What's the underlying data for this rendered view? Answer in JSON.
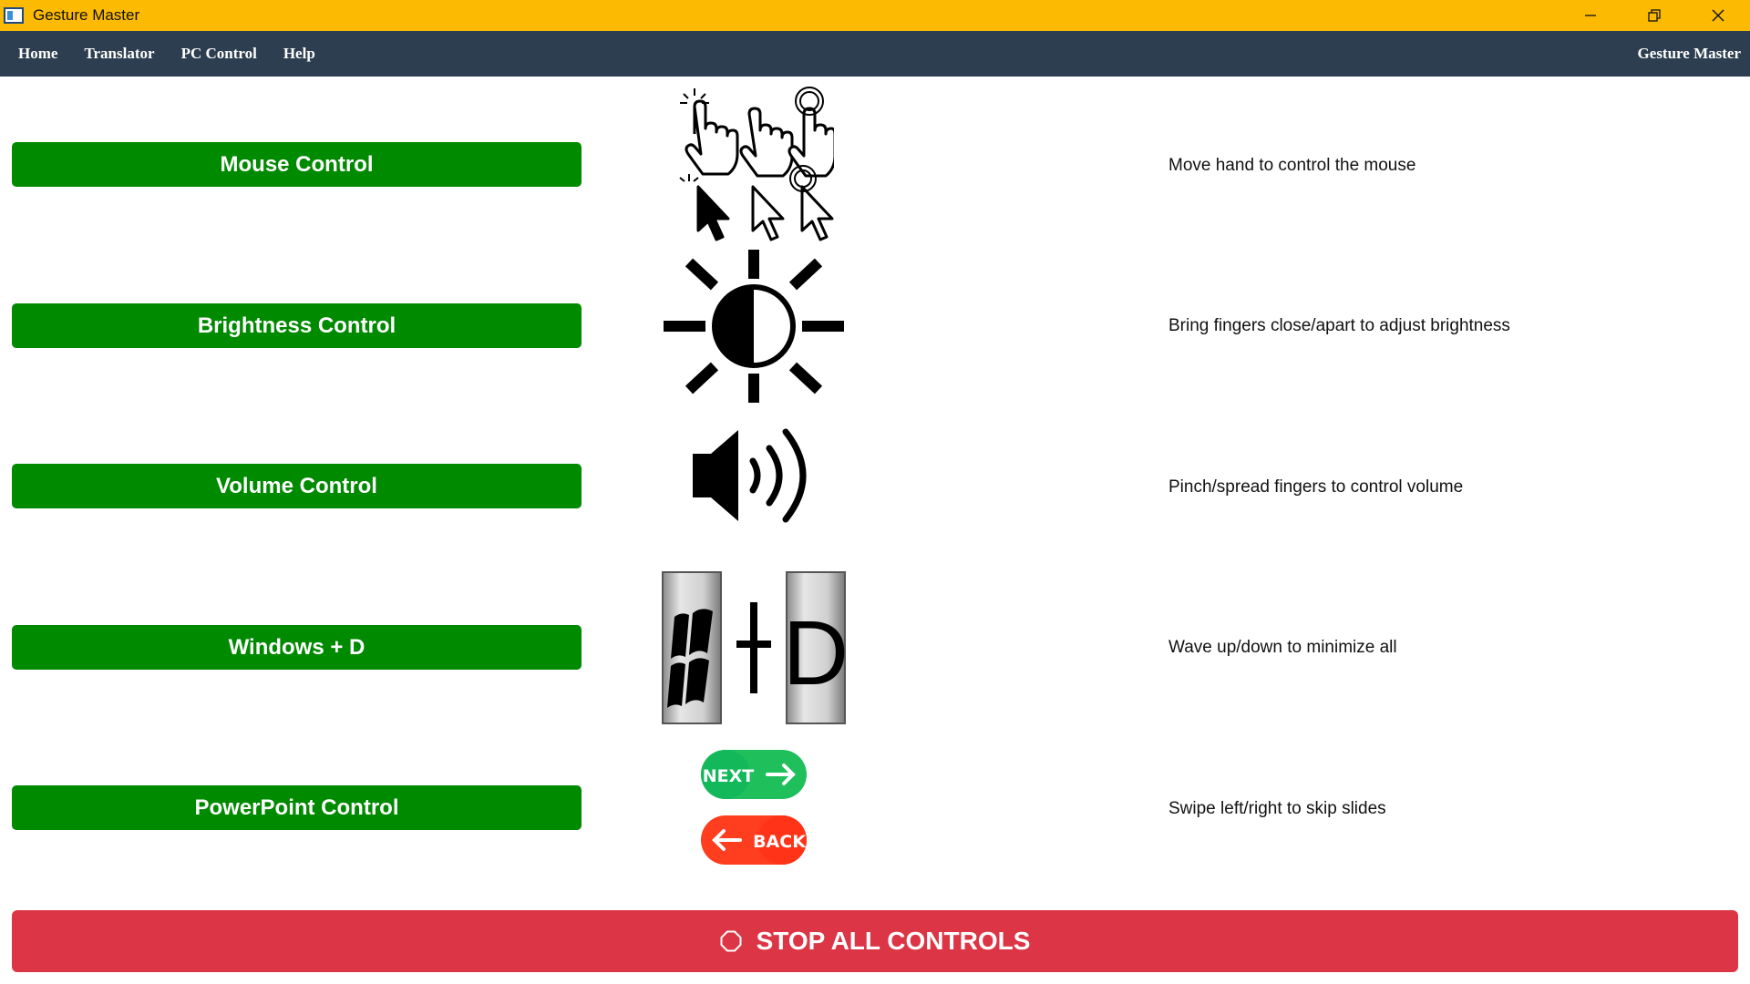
{
  "window": {
    "title": "Gesture Master",
    "titlebar_color": "#fcba03"
  },
  "menu": {
    "items": [
      "Home",
      "Translator",
      "PC Control",
      "Help"
    ],
    "brand": "Gesture Master",
    "background": "#2d3e50"
  },
  "controls": [
    {
      "label": "Mouse Control",
      "description": "Move hand to control the mouse",
      "icon": "hand-cursor-icon"
    },
    {
      "label": "Brightness Control",
      "description": "Bring fingers close/apart to adjust brightness",
      "icon": "brightness-icon"
    },
    {
      "label": "Volume Control",
      "description": "Pinch/spread fingers to control volume",
      "icon": "speaker-volume-icon"
    },
    {
      "label": "Windows + D",
      "description": "Wave up/down to minimize all",
      "icon": "windows-d-keys-icon",
      "key_plus": "+",
      "key_d": "D"
    },
    {
      "label": "PowerPoint Control",
      "description": "Swipe left/right to skip slides",
      "icon": "next-back-icon",
      "next_label": "NEXT",
      "back_label": "BACK"
    }
  ],
  "control_button_color": "#008a00",
  "stop_button": {
    "label": "STOP ALL CONTROLS",
    "color": "#dc3545",
    "icon": "stop-octagon-icon"
  }
}
